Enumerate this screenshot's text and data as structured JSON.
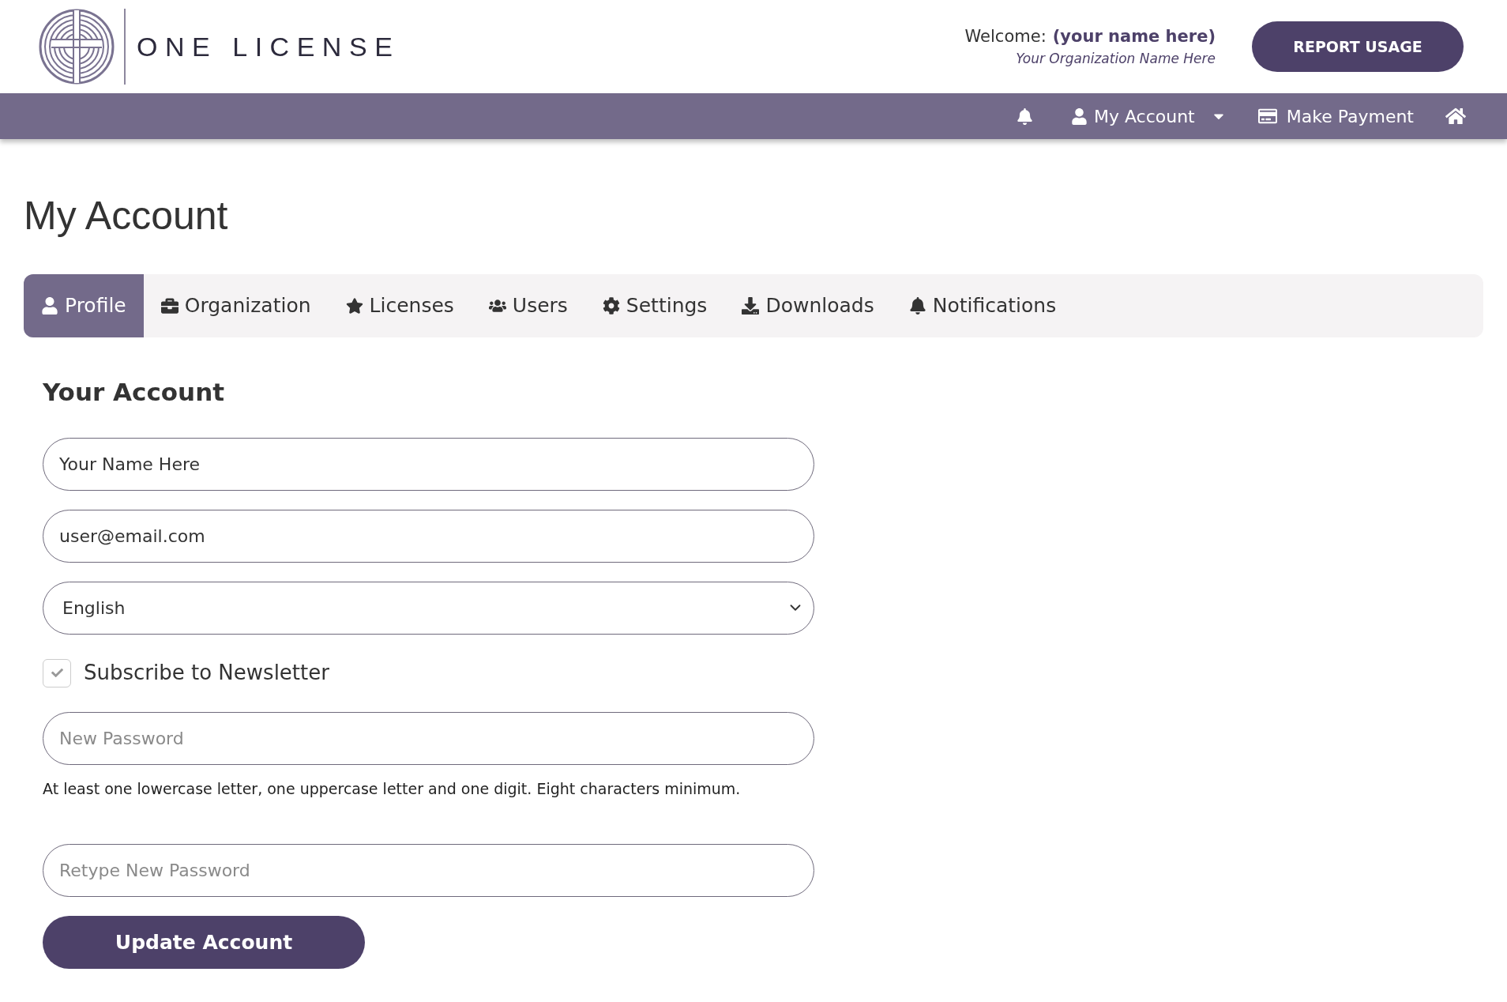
{
  "header": {
    "brand": "ONE LICENSE",
    "welcome_label": "Welcome:",
    "user_name": "(your name here)",
    "organization": "Your Organization Name Here",
    "report_button": "REPORT USAGE"
  },
  "nav": {
    "account_menu": "My Account",
    "payment_link": "Make Payment"
  },
  "page_title": "My Account",
  "tabs": [
    {
      "label": "Profile",
      "selected": true
    },
    {
      "label": "Organization",
      "selected": false
    },
    {
      "label": "Licenses",
      "selected": false
    },
    {
      "label": "Users",
      "selected": false
    },
    {
      "label": "Settings",
      "selected": false
    },
    {
      "label": "Downloads",
      "selected": false
    },
    {
      "label": "Notifications",
      "selected": false
    }
  ],
  "form": {
    "section_title": "Your Account",
    "fields": [
      {
        "kind": "input",
        "value": "Your Name Here"
      },
      {
        "kind": "input",
        "value": "user@email.com"
      },
      {
        "kind": "select",
        "value": "English"
      },
      {
        "kind": "checkbox",
        "label": "Subscribe to Newsletter",
        "checked": true
      },
      {
        "kind": "password",
        "placeholder": "New Password",
        "hint": "At least one lowercase letter, one uppercase letter and one digit. Eight characters minimum."
      },
      {
        "kind": "password",
        "placeholder": "Retype New Password"
      }
    ],
    "submit_button": "Update Account"
  }
}
